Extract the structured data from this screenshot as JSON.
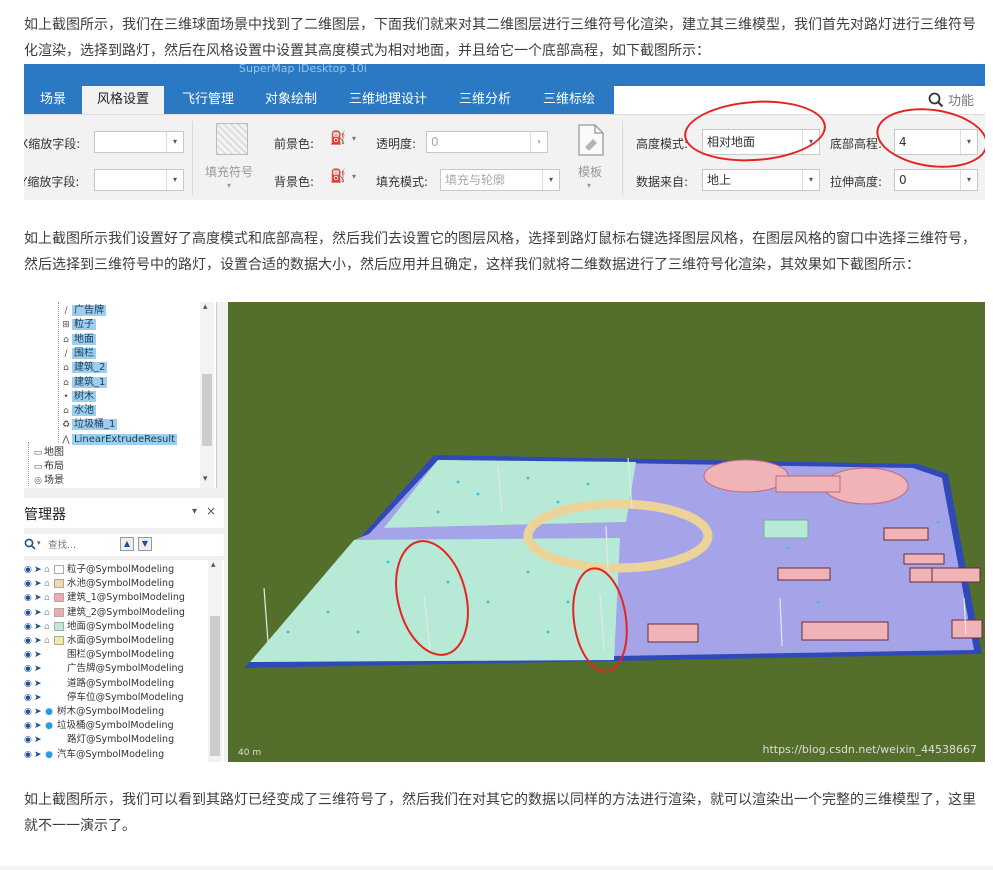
{
  "paragraphs": {
    "p1": "如上截图所示，我们在三维球面场景中找到了二维图层，下面我们就来对其二维图层进行三维符号化渲染，建立其三维模型，我们首先对路灯进行三维符号化渲染，选择到路灯，然后在风格设置中设置其高度模式为相对地面，并且给它一个底部高程，如下截图所示：",
    "p2": "如上截图所示我们设置好了高度模式和底部高程，然后我们去设置它的图层风格，选择到路灯鼠标右键选择图层风格，在图层风格的窗口中选择三维符号，然后选择到三维符号中的路灯，设置合适的数据大小，然后应用并且确定，这样我们就将二维数据进行了三维符号化渲染，其效果如下截图所示：",
    "p3": "如上截图所示，我们可以看到其路灯已经变成了三维符号了，然后我们在对其它的数据以同样的方法进行渲染，就可以渲染出一个完整的三维模型了，这里就不一一演示了。"
  },
  "ribbon": {
    "app_title": "SuperMap iDesktop 10i",
    "tabs": [
      "场景",
      "风格设置",
      "飞行管理",
      "对象绘制",
      "三维地理设计",
      "三维分析",
      "三维标绘"
    ],
    "active_tab": "风格设置",
    "search_icon": "search-icon",
    "search_label": "功能",
    "x_scale_label": "X缩放字段:",
    "y_scale_label": "Y缩放字段:",
    "fill_symbol_label": "填充符号",
    "foreground_label": "前景色:",
    "background_label": "背景色:",
    "transparency_label": "透明度:",
    "transparency_value": "0",
    "fill_mode_label": "填充模式:",
    "fill_mode_value": "填充与轮廓",
    "template_label": "模板",
    "height_mode_label": "高度模式:",
    "height_mode_value": "相对地面",
    "bottom_altitude_label": "底部高程:",
    "bottom_altitude_value": "4",
    "data_source_label": "数据来自:",
    "data_source_value": "地上",
    "extrude_label": "拉伸高度:",
    "extrude_value": "0",
    "accent_color": "#2b79c2",
    "annotation_color": "#e52420"
  },
  "tree": {
    "items": [
      {
        "icon": "line-icon",
        "label": "广告牌",
        "selected": true
      },
      {
        "icon": "cad-icon",
        "label": "粒子",
        "selected": true
      },
      {
        "icon": "polygon-icon",
        "label": "地面",
        "selected": true
      },
      {
        "icon": "line-icon",
        "label": "围栏",
        "selected": true
      },
      {
        "icon": "polygon-icon",
        "label": "建筑_2",
        "selected": true
      },
      {
        "icon": "polygon-icon",
        "label": "建筑_1",
        "selected": true
      },
      {
        "icon": "point-icon",
        "label": "树木",
        "selected": true
      },
      {
        "icon": "polygon-icon",
        "label": "水池",
        "selected": true
      },
      {
        "icon": "trash-icon",
        "label": "垃圾桶_1",
        "selected": true
      },
      {
        "icon": "network-icon",
        "label": "LinearExtrudeResult",
        "selected": true
      }
    ],
    "roots": [
      {
        "icon": "map-icon",
        "label": "地图"
      },
      {
        "icon": "layout-icon",
        "label": "布局"
      },
      {
        "icon": "scene-icon",
        "label": "场景"
      }
    ]
  },
  "layer_manager": {
    "title": "管理器",
    "pin": "▾",
    "close": "×",
    "search_placeholder": "查找...",
    "layers": [
      {
        "label": "粒子@SymbolModeling",
        "swatch": "",
        "kind": "cad"
      },
      {
        "label": "水池@SymbolModeling",
        "swatch": "#f3d9a8",
        "kind": "region"
      },
      {
        "label": "建筑_1@SymbolModeling",
        "swatch": "#f2a9b2",
        "kind": "region"
      },
      {
        "label": "建筑_2@SymbolModeling",
        "swatch": "#f2a9b2",
        "kind": "region"
      },
      {
        "label": "地面@SymbolModeling",
        "swatch": "#bde8d6",
        "kind": "region"
      },
      {
        "label": "水面@SymbolModeling",
        "swatch": "#f3eb9e",
        "kind": "region"
      },
      {
        "label": "围栏@SymbolModeling",
        "swatch": "",
        "kind": "line"
      },
      {
        "label": "广告牌@SymbolModeling",
        "swatch": "",
        "kind": "line"
      },
      {
        "label": "道路@SymbolModeling",
        "swatch": "",
        "kind": "line"
      },
      {
        "label": "停车位@SymbolModeling",
        "swatch": "",
        "kind": "line"
      },
      {
        "label": "树木@SymbolModeling",
        "swatch": "",
        "kind": "point"
      },
      {
        "label": "垃圾桶@SymbolModeling",
        "swatch": "",
        "kind": "point"
      },
      {
        "label": "路灯@SymbolModeling",
        "swatch": "",
        "kind": "line"
      },
      {
        "label": "汽车@SymbolModeling",
        "swatch": "",
        "kind": "point"
      }
    ]
  },
  "scene": {
    "scale_label": "40 m",
    "watermark": "https://blog.csdn.net/weixin_44538667",
    "ground_color": "#546f2b",
    "plaza_color": "#a6a4e8",
    "lawn_color": "#b7ead6",
    "ring_color": "#ecd39a",
    "building_color": "#f0b3b8"
  }
}
